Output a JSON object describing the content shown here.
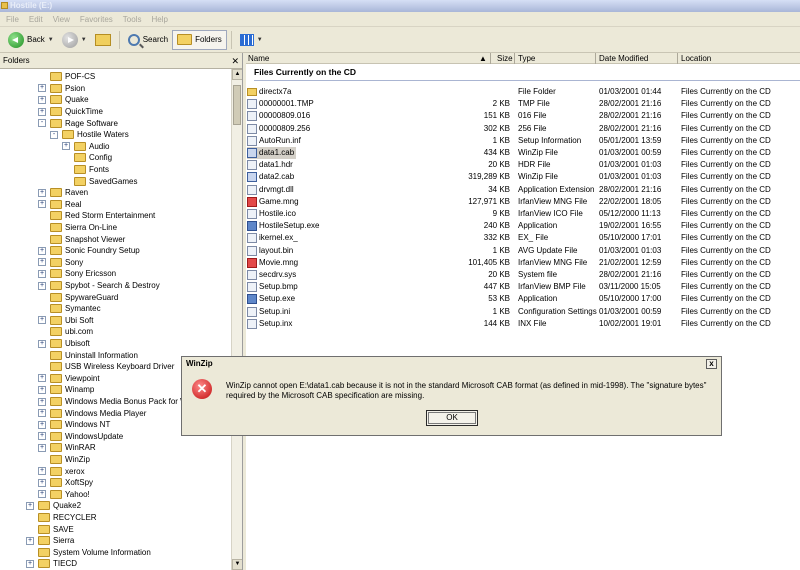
{
  "window": {
    "title": "Hostile (E:)"
  },
  "menu": [
    "File",
    "Edit",
    "View",
    "Favorites",
    "Tools",
    "Help"
  ],
  "toolbar": {
    "back_label": "Back",
    "search_label": "Search",
    "folders_label": "Folders"
  },
  "folders_pane": {
    "header": "Folders",
    "tree": [
      {
        "label": "POF-CS",
        "indent": 1,
        "expander": ""
      },
      {
        "label": "Psion",
        "indent": 1,
        "expander": "+"
      },
      {
        "label": "Quake",
        "indent": 1,
        "expander": "+"
      },
      {
        "label": "QuickTime",
        "indent": 1,
        "expander": "+"
      },
      {
        "label": "Rage Software",
        "indent": 1,
        "expander": "-"
      },
      {
        "label": "Hostile Waters",
        "indent": 2,
        "expander": "-"
      },
      {
        "label": "Audio",
        "indent": 3,
        "expander": "+"
      },
      {
        "label": "Config",
        "indent": 3,
        "expander": ""
      },
      {
        "label": "Fonts",
        "indent": 3,
        "expander": ""
      },
      {
        "label": "SavedGames",
        "indent": 3,
        "expander": ""
      },
      {
        "label": "Raven",
        "indent": 1,
        "expander": "+"
      },
      {
        "label": "Real",
        "indent": 1,
        "expander": "+"
      },
      {
        "label": "Red Storm Entertainment",
        "indent": 1,
        "expander": ""
      },
      {
        "label": "Sierra On-Line",
        "indent": 1,
        "expander": ""
      },
      {
        "label": "Snapshot Viewer",
        "indent": 1,
        "expander": ""
      },
      {
        "label": "Sonic Foundry Setup",
        "indent": 1,
        "expander": "+"
      },
      {
        "label": "Sony",
        "indent": 1,
        "expander": "+"
      },
      {
        "label": "Sony Ericsson",
        "indent": 1,
        "expander": "+"
      },
      {
        "label": "Spybot - Search & Destroy",
        "indent": 1,
        "expander": "+"
      },
      {
        "label": "SpywareGuard",
        "indent": 1,
        "expander": ""
      },
      {
        "label": "Symantec",
        "indent": 1,
        "expander": ""
      },
      {
        "label": "Ubi Soft",
        "indent": 1,
        "expander": "+"
      },
      {
        "label": "ubi.com",
        "indent": 1,
        "expander": ""
      },
      {
        "label": "Ubisoft",
        "indent": 1,
        "expander": "+"
      },
      {
        "label": "Uninstall Information",
        "indent": 1,
        "expander": ""
      },
      {
        "label": "USB Wireless Keyboard Driver",
        "indent": 1,
        "expander": ""
      },
      {
        "label": "Viewpoint",
        "indent": 1,
        "expander": "+"
      },
      {
        "label": "Winamp",
        "indent": 1,
        "expander": "+"
      },
      {
        "label": "Windows Media Bonus Pack for Wi",
        "indent": 1,
        "expander": "+"
      },
      {
        "label": "Windows Media Player",
        "indent": 1,
        "expander": "+"
      },
      {
        "label": "Windows NT",
        "indent": 1,
        "expander": "+"
      },
      {
        "label": "WindowsUpdate",
        "indent": 1,
        "expander": "+"
      },
      {
        "label": "WinRAR",
        "indent": 1,
        "expander": "+"
      },
      {
        "label": "WinZip",
        "indent": 1,
        "expander": ""
      },
      {
        "label": "xerox",
        "indent": 1,
        "expander": "+"
      },
      {
        "label": "XoftSpy",
        "indent": 1,
        "expander": "+"
      },
      {
        "label": "Yahoo!",
        "indent": 1,
        "expander": "+"
      },
      {
        "label": "Quake2",
        "indent": 0,
        "expander": "+"
      },
      {
        "label": "RECYCLER",
        "indent": 0,
        "expander": ""
      },
      {
        "label": "SAVE",
        "indent": 0,
        "expander": ""
      },
      {
        "label": "Sierra",
        "indent": 0,
        "expander": "+"
      },
      {
        "label": "System Volume Information",
        "indent": 0,
        "expander": ""
      },
      {
        "label": "TIECD",
        "indent": 0,
        "expander": "+"
      }
    ]
  },
  "file_list": {
    "columns": {
      "name": "Name",
      "size": "Size",
      "type": "Type",
      "date": "Date Modified",
      "location": "Location"
    },
    "sort_indicator": "▲",
    "group_title": "Files Currently on the CD",
    "rows": [
      {
        "name": "directx7a",
        "size": "",
        "type": "File Folder",
        "date": "01/03/2001 01:44",
        "location": "Files Currently on the CD",
        "icon": "folder"
      },
      {
        "name": "00000001.TMP",
        "size": "2 KB",
        "type": "TMP File",
        "date": "28/02/2001 21:16",
        "location": "Files Currently on the CD",
        "icon": "file"
      },
      {
        "name": "00000809.016",
        "size": "151 KB",
        "type": "016 File",
        "date": "28/02/2001 21:16",
        "location": "Files Currently on the CD",
        "icon": "file"
      },
      {
        "name": "00000809.256",
        "size": "302 KB",
        "type": "256 File",
        "date": "28/02/2001 21:16",
        "location": "Files Currently on the CD",
        "icon": "file"
      },
      {
        "name": "AutoRun.inf",
        "size": "1 KB",
        "type": "Setup Information",
        "date": "05/01/2001 13:59",
        "location": "Files Currently on the CD",
        "icon": "file"
      },
      {
        "name": "data1.cab",
        "size": "434 KB",
        "type": "WinZip File",
        "date": "01/03/2001 00:59",
        "location": "Files Currently on the CD",
        "icon": "zip",
        "selected": true
      },
      {
        "name": "data1.hdr",
        "size": "20 KB",
        "type": "HDR File",
        "date": "01/03/2001 01:03",
        "location": "Files Currently on the CD",
        "icon": "file"
      },
      {
        "name": "data2.cab",
        "size": "319,289 KB",
        "type": "WinZip File",
        "date": "01/03/2001 01:03",
        "location": "Files Currently on the CD",
        "icon": "zip"
      },
      {
        "name": "drvmgt.dll",
        "size": "34 KB",
        "type": "Application Extension",
        "date": "28/02/2001 21:16",
        "location": "Files Currently on the CD",
        "icon": "file"
      },
      {
        "name": "Game.mng",
        "size": "127,971 KB",
        "type": "IrfanView MNG File",
        "date": "22/02/2001 18:05",
        "location": "Files Currently on the CD",
        "icon": "irfan"
      },
      {
        "name": "Hostile.ico",
        "size": "9 KB",
        "type": "IrfanView ICO File",
        "date": "05/12/2000 11:13",
        "location": "Files Currently on the CD",
        "icon": "file"
      },
      {
        "name": "HostileSetup.exe",
        "size": "240 KB",
        "type": "Application",
        "date": "19/02/2001 16:55",
        "location": "Files Currently on the CD",
        "icon": "app"
      },
      {
        "name": "ikernel.ex_",
        "size": "332 KB",
        "type": "EX_ File",
        "date": "05/10/2000 17:01",
        "location": "Files Currently on the CD",
        "icon": "file"
      },
      {
        "name": "layout.bin",
        "size": "1 KB",
        "type": "AVG Update File",
        "date": "01/03/2001 01:03",
        "location": "Files Currently on the CD",
        "icon": "file"
      },
      {
        "name": "Movie.mng",
        "size": "101,405 KB",
        "type": "IrfanView MNG File",
        "date": "21/02/2001 12:59",
        "location": "Files Currently on the CD",
        "icon": "irfan"
      },
      {
        "name": "secdrv.sys",
        "size": "20 KB",
        "type": "System file",
        "date": "28/02/2001 21:16",
        "location": "Files Currently on the CD",
        "icon": "file"
      },
      {
        "name": "Setup.bmp",
        "size": "447 KB",
        "type": "IrfanView BMP File",
        "date": "03/11/2000 15:05",
        "location": "Files Currently on the CD",
        "icon": "file"
      },
      {
        "name": "Setup.exe",
        "size": "53 KB",
        "type": "Application",
        "date": "05/10/2000 17:00",
        "location": "Files Currently on the CD",
        "icon": "app"
      },
      {
        "name": "Setup.ini",
        "size": "1 KB",
        "type": "Configuration Settings",
        "date": "01/03/2001 00:59",
        "location": "Files Currently on the CD",
        "icon": "file"
      },
      {
        "name": "Setup.inx",
        "size": "144 KB",
        "type": "INX File",
        "date": "10/02/2001 19:01",
        "location": "Files Currently on the CD",
        "icon": "file"
      }
    ]
  },
  "dialog": {
    "title": "WinZip",
    "close_glyph": "x",
    "icon_glyph": "✕",
    "message": "WinZip cannot open E:\\data1.cab because it is not in the standard Microsoft CAB format (as defined in mid-1998).  The \"signature bytes\" required by the Microsoft CAB specification are missing.",
    "ok_label": "OK"
  },
  "colors": {
    "folder": "#f3d163",
    "selection": "#d4d0c8",
    "error": "#c10c0c"
  }
}
